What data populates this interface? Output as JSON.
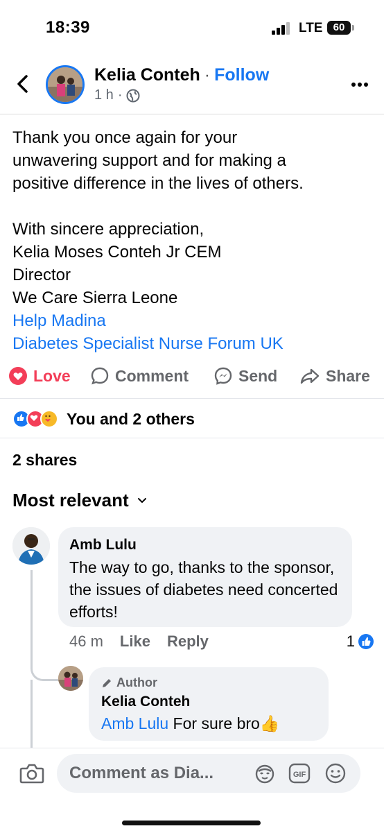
{
  "status_bar": {
    "time": "18:39",
    "network": "LTE",
    "battery": "60"
  },
  "header": {
    "name": "Kelia Conteh",
    "separator": "·",
    "follow_label": "Follow",
    "time": "1 h",
    "meta_separator": "·"
  },
  "post": {
    "lines": [
      "Thank you once again for your",
      "unwavering support and for making a",
      "positive difference in the lives of others.",
      "",
      "With sincere appreciation,",
      "Kelia Moses Conteh Jr CEM",
      "Director",
      "We Care Sierra Leone"
    ],
    "link1": "Help Madina",
    "link2": "Diabetes Specialist Nurse Forum UK"
  },
  "actions": {
    "love": "Love",
    "comment": "Comment",
    "send": "Send",
    "share": "Share"
  },
  "reactions": {
    "label": "You and 2 others"
  },
  "shares": "2 shares",
  "sort_label": "Most relevant",
  "comment": {
    "author": "Amb Lulu",
    "text": "The way to go, thanks to the sponsor, the issues of diabetes need concerted efforts!",
    "time": "46 m",
    "like": "Like",
    "reply": "Reply",
    "reaction_count": "1"
  },
  "reply": {
    "badge": "Author",
    "author": "Kelia Conteh",
    "mention": "Amb Lulu",
    "text": " For sure bro👍"
  },
  "composer": {
    "placeholder": "Comment as Dia...",
    "gif": "GIF"
  },
  "colors": {
    "accent": "#1877f2",
    "love": "#f33e58",
    "muted": "#65676b",
    "bubble": "#f0f2f5"
  }
}
